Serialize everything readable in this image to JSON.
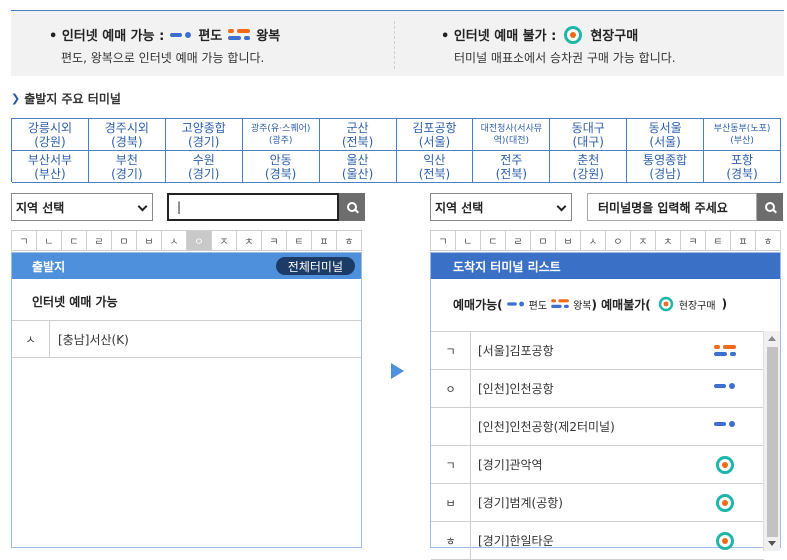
{
  "legend": {
    "online": {
      "title": "• 인터넷 예매 가능 :",
      "oneway_label": "편도",
      "round_label": "왕복",
      "desc": "편도, 왕복으로 인터넷 예매 가능 합니다."
    },
    "offline": {
      "title": "• 인터넷 예매 불가 :",
      "onsite_label": "현장구매",
      "desc": "터미널 매표소에서 승차권 구매 가능 합니다."
    }
  },
  "section_title": "출발지 주요 터미널",
  "terminals": [
    {
      "name": "강릉시외",
      "region": "(강원)",
      "small": false
    },
    {
      "name": "경주시외",
      "region": "(경북)",
      "small": false
    },
    {
      "name": "고양종합",
      "region": "(경기)",
      "small": false
    },
    {
      "name": "광주(유·스퀘어)",
      "region": "(광주)",
      "small": true
    },
    {
      "name": "군산",
      "region": "(전북)",
      "small": false
    },
    {
      "name": "김포공항",
      "region": "(서울)",
      "small": false
    },
    {
      "name": "대전청사(서사뮤",
      "region": "역)(대전)",
      "small": true
    },
    {
      "name": "동대구",
      "region": "(대구)",
      "small": false
    },
    {
      "name": "동서울",
      "region": "(서울)",
      "small": false
    },
    {
      "name": "부산동부(노포)",
      "region": "(부산)",
      "small": true
    },
    {
      "name": "부산서부",
      "region": "(부산)",
      "small": false
    },
    {
      "name": "부천",
      "region": "(경기)",
      "small": false
    },
    {
      "name": "수원",
      "region": "(경기)",
      "small": false
    },
    {
      "name": "안동",
      "region": "(경북)",
      "small": false
    },
    {
      "name": "울산",
      "region": "(울산)",
      "small": false
    },
    {
      "name": "익산",
      "region": "(전북)",
      "small": false
    },
    {
      "name": "전주",
      "region": "(전북)",
      "small": false
    },
    {
      "name": "춘천",
      "region": "(강원)",
      "small": false
    },
    {
      "name": "통영종합",
      "region": "(경남)",
      "small": false
    },
    {
      "name": "포항",
      "region": "(경북)",
      "small": false
    }
  ],
  "departure": {
    "region_select": "지역 선택",
    "search_value": "|",
    "consonants": [
      "ㄱ",
      "ㄴ",
      "ㄷ",
      "ㄹ",
      "ㅁ",
      "ㅂ",
      "ㅅ",
      "ㅇ",
      "ㅈ",
      "ㅊ",
      "ㅋ",
      "ㅌ",
      "ㅍ",
      "ㅎ"
    ],
    "selected_consonant": 7,
    "header": "출발지",
    "all_button": "전체터미널",
    "sub_label": "인터넷 예매 가능",
    "rows": [
      {
        "initial": "ㅅ",
        "name": "[충남]서산(K)"
      }
    ]
  },
  "arrival": {
    "region_select": "지역 선택",
    "search_placeholder": "터미널명을 입력해 주세요",
    "consonants": [
      "ㄱ",
      "ㄴ",
      "ㄷ",
      "ㄹ",
      "ㅁ",
      "ㅂ",
      "ㅅ",
      "ㅇ",
      "ㅈ",
      "ㅊ",
      "ㅋ",
      "ㅌ",
      "ㅍ",
      "ㅎ"
    ],
    "header": "도착지 터미널 리스트",
    "legend": {
      "possible": "예매가능(",
      "oneway": "편도",
      "round": "왕복",
      "close_open": ") 예매불가(",
      "onsite": "현장구매",
      "close": ")"
    },
    "rows": [
      {
        "initial": "ㄱ",
        "name": "[서울]김포공항",
        "icon": "round"
      },
      {
        "initial": "ㅇ",
        "name": "[인천]인천공항",
        "icon": "oneway"
      },
      {
        "initial": "",
        "name": "[인천]인천공항(제2터미널)",
        "icon": "oneway"
      },
      {
        "initial": "ㄱ",
        "name": "[경기]관악역",
        "icon": "onsite"
      },
      {
        "initial": "ㅂ",
        "name": "[경기]범계(공항)",
        "icon": "onsite"
      },
      {
        "initial": "ㅎ",
        "name": "[경기]한일타운",
        "icon": "onsite"
      }
    ]
  },
  "colors": {
    "accent": "#3a70c6",
    "header_light": "#4e90db",
    "oneway": "#3d6fcf",
    "round": "#f06a1a",
    "onsite": "#1fb5a8"
  }
}
